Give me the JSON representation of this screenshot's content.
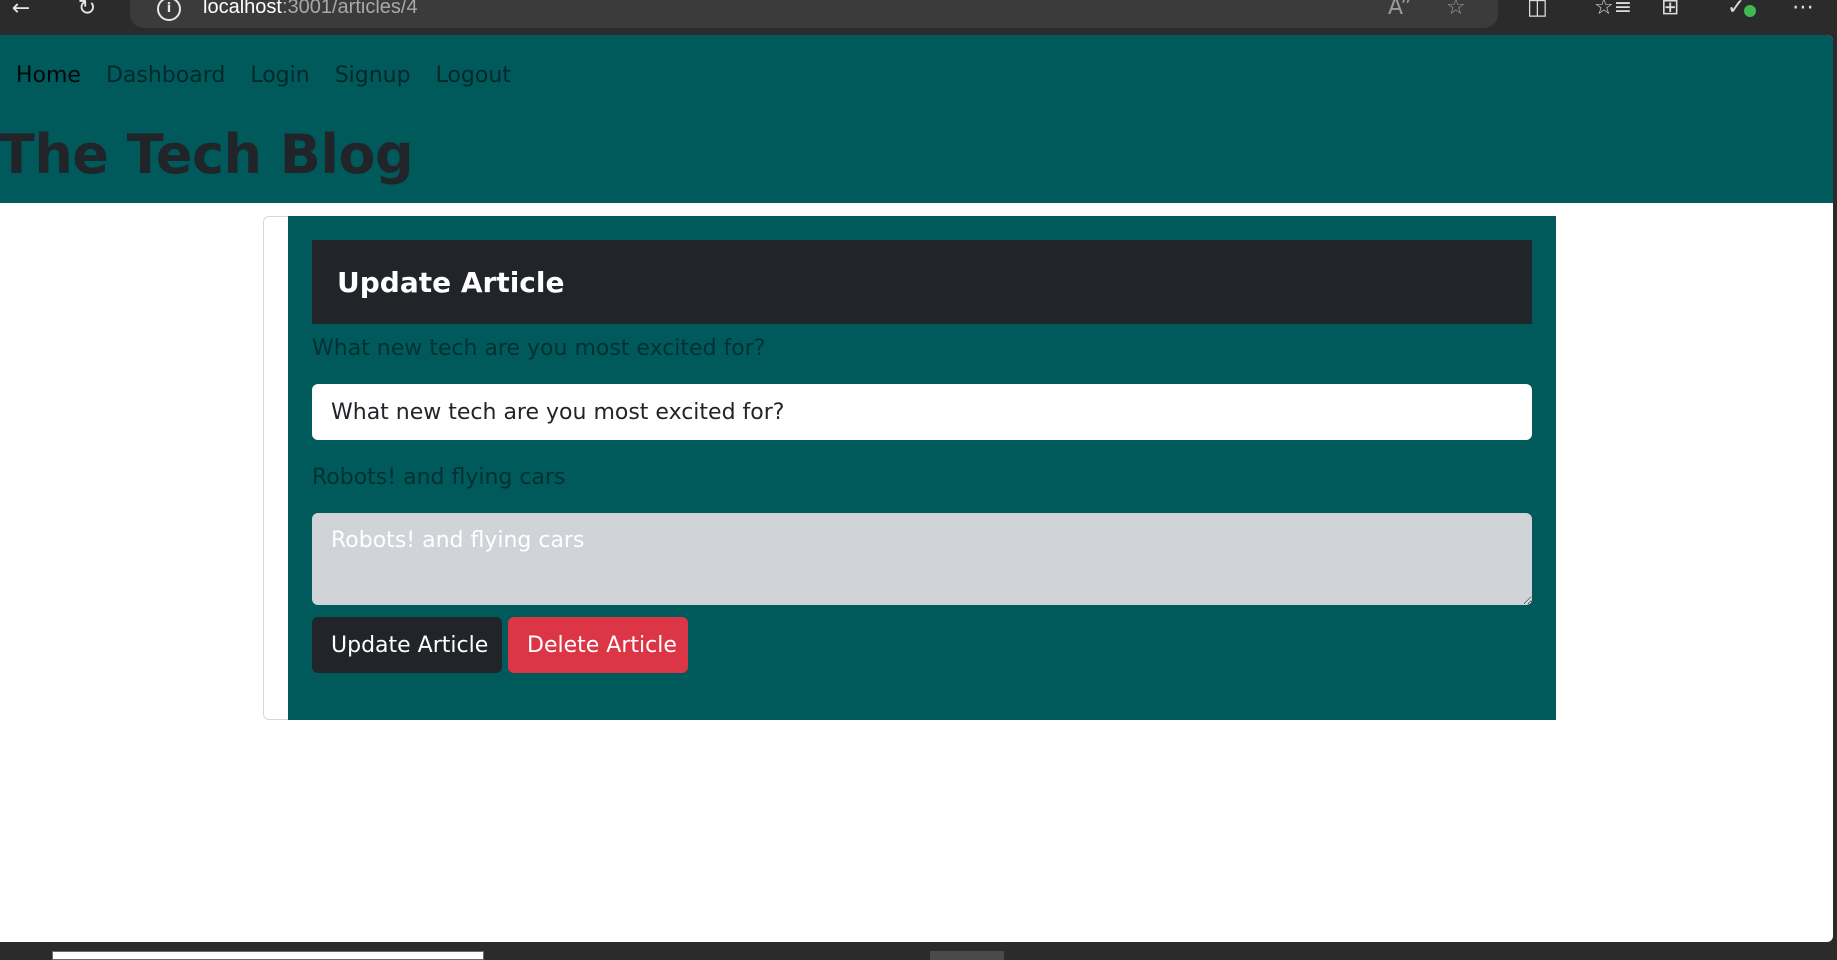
{
  "browser": {
    "back_icon": "back-arrow-icon",
    "refresh_icon": "refresh-icon",
    "url_host": "localhost",
    "url_rest": ":3001/articles/4"
  },
  "site": {
    "nav": [
      "Home",
      "Dashboard",
      "Login",
      "Signup",
      "Logout"
    ],
    "active_nav": "Home",
    "title": "The Tech Blog",
    "header_color": "#005a5c"
  },
  "form": {
    "heading": "Update Article",
    "title_label": "What new tech are you most excited for?",
    "title_value": "What new tech are you most excited for?",
    "body_label": "Robots! and flying cars",
    "body_placeholder": "Robots! and flying cars",
    "update_button": "Update Article",
    "delete_button": "Delete Article",
    "update_color": "#212529",
    "delete_color": "#dc3545"
  }
}
